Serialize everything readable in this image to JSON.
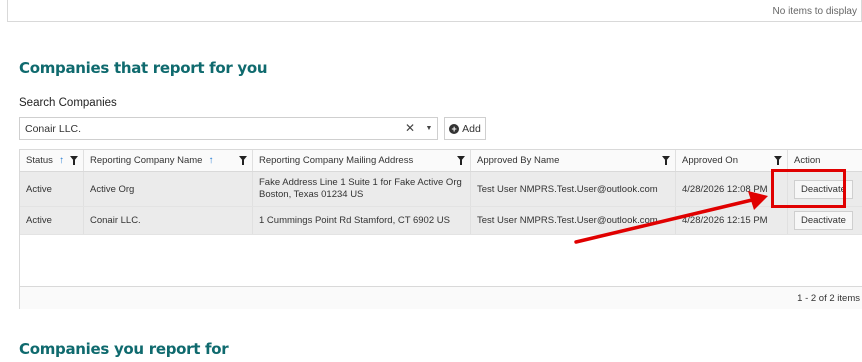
{
  "top_panel": {
    "empty_text": "No items to display"
  },
  "section1": {
    "title": "Companies that report for you"
  },
  "search": {
    "label": "Search Companies",
    "value": "Conair LLC.",
    "clear_glyph": "✕",
    "dropdown_glyph": "▼",
    "add_label": "Add",
    "add_icon": "plus-circle-icon"
  },
  "grid": {
    "columns": [
      {
        "label": "Status",
        "sorted": "ascending",
        "filter": true
      },
      {
        "label": "Reporting Company Name",
        "sorted": "ascending",
        "filter": true
      },
      {
        "label": "Reporting Company Mailing Address",
        "filter": true
      },
      {
        "label": "Approved By Name",
        "filter": true
      },
      {
        "label": "Approved On",
        "filter": true
      },
      {
        "label": "Action"
      }
    ],
    "sort_glyph": "↑",
    "rows": [
      {
        "status": "Active",
        "company": "Active Org",
        "address": "Fake Address Line 1 Suite 1 for Fake Active Org Boston, Texas 01234 US",
        "approved_by": "Test User NMPRS.Test.User@outlook.com",
        "approved_on": "4/28/2026 12:08 PM",
        "action": "Deactivate"
      },
      {
        "status": "Active",
        "company": "Conair LLC.",
        "address": "1 Cummings Point Rd Stamford, CT 6902 US",
        "approved_by": "Test User NMPRS.Test.User@outlook.com",
        "approved_on": "4/28/2026 12:15 PM",
        "action": "Deactivate"
      }
    ],
    "pager": "1 - 2 of 2 items"
  },
  "section2": {
    "title": "Companies you report for"
  },
  "annotation": {
    "color": "#e00000"
  },
  "colors": {
    "title": "#0f6a6e",
    "sort_arrow": "#2a7fd4",
    "row_bg": "#ebebeb"
  }
}
